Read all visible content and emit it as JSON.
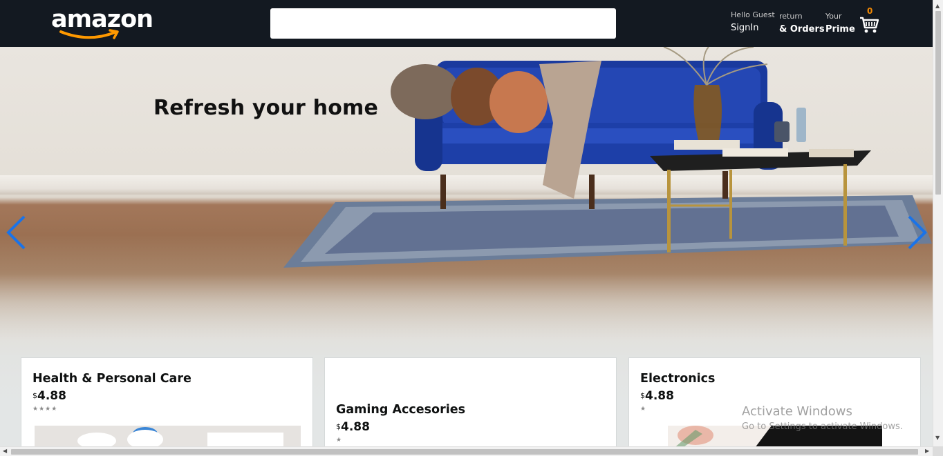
{
  "header": {
    "logo_text": "amazon",
    "search": {
      "value": "",
      "placeholder": ""
    },
    "signin": {
      "line1": "Hello Guest",
      "line2": "SignIn"
    },
    "orders": {
      "line1": "return",
      "line2": "& Orders"
    },
    "prime": {
      "line1": "Your",
      "line2": "Prime"
    },
    "cart": {
      "count": "0",
      "icon": "cart-icon"
    },
    "colors": {
      "background": "#131921",
      "accent": "#f08804"
    }
  },
  "hero": {
    "title": "Refresh your home",
    "prev_icon": "chevron-left-icon",
    "next_icon": "chevron-right-icon",
    "arrow_color": "#1a73e8"
  },
  "cards": [
    {
      "title": "Health & Personal Care",
      "currency": "$",
      "price": "4.88",
      "stars": "★★★★"
    },
    {
      "title": "Gaming Accesories",
      "currency": "$",
      "price": "4.88",
      "stars": "★"
    },
    {
      "title": "Electronics",
      "currency": "$",
      "price": "4.88",
      "stars": "★"
    }
  ],
  "watermark": {
    "line1": "Activate Windows",
    "line2": "Go to Settings to activate Windows."
  }
}
